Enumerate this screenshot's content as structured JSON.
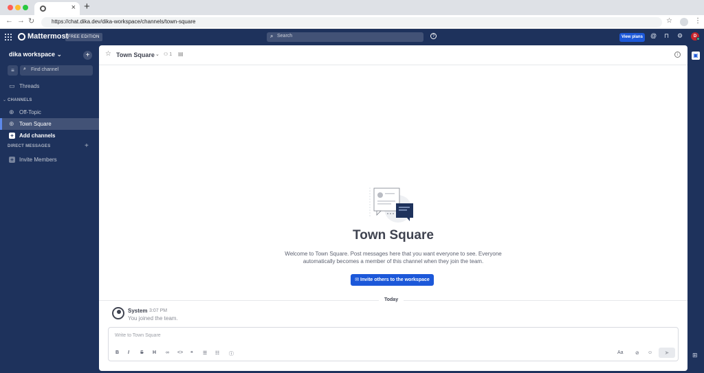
{
  "browser": {
    "tab_close": "×",
    "new_tab": "+",
    "url": "https://chat.dika.dev/dika-workspace/channels/town-square",
    "traffic_colors": [
      "#ff5f57",
      "#febc2e",
      "#28c840"
    ]
  },
  "header": {
    "brand": "Mattermost",
    "edition": "FREE EDITION",
    "search_placeholder": "Search",
    "view_plans": "View plans",
    "avatar_initial": "D"
  },
  "sidebar": {
    "team_name": "dika workspace ⌄",
    "find_channel": "Find channel",
    "threads": "Threads",
    "channels_section": "CHANNELS",
    "channels": [
      {
        "label": "Off-Topic",
        "active": false
      },
      {
        "label": "Town Square",
        "active": true
      }
    ],
    "add_channels": "Add channels",
    "dm_section": "DIRECT MESSAGES",
    "invite_members": "Invite Members"
  },
  "channel": {
    "name": "Town Square",
    "member_count": "1",
    "intro_title": "Town Square",
    "intro_desc": "Welcome to Town Square. Post messages here that you want everyone to see. Everyone automatically becomes a member of this channel when they join the team.",
    "invite_button": "Invite others to the workspace"
  },
  "timeline": {
    "date_separator": "Today",
    "post": {
      "user": "System",
      "time": "3:07 PM",
      "text": "You joined the team."
    }
  },
  "composer": {
    "placeholder": "Write to Town Square",
    "format_buttons": [
      "B",
      "I",
      "S",
      "H"
    ],
    "text_size": "Aa"
  },
  "colors": {
    "sidebar_bg": "#1e325c",
    "accent": "#1c58d9",
    "active_indicator": "#5d89ea",
    "online": "#3db887"
  }
}
